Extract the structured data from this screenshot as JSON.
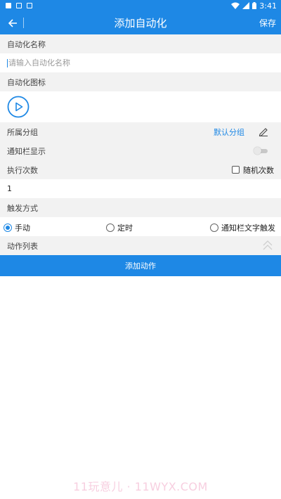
{
  "status_bar": {
    "time": "3:41"
  },
  "app_bar": {
    "title": "添加自动化",
    "save_label": "保存"
  },
  "name_section": {
    "label": "自动化名称",
    "placeholder": "请输入自动化名称",
    "value": ""
  },
  "icon_section": {
    "label": "自动化图标",
    "icon": "play-circle-icon"
  },
  "group": {
    "label": "所属分组",
    "value": "默认分组"
  },
  "notify": {
    "label": "通知栏显示",
    "enabled": false
  },
  "exec_count": {
    "label": "执行次数",
    "random_label": "随机次数",
    "random_checked": false,
    "value": "1"
  },
  "trigger": {
    "label": "触发方式",
    "options": [
      {
        "label": "手动",
        "selected": true
      },
      {
        "label": "定时",
        "selected": false
      },
      {
        "label": "通知栏文字触发",
        "selected": false
      }
    ]
  },
  "actions": {
    "label": "动作列表",
    "add_label": "添加动作"
  },
  "watermark": "11玩意儿 · 11WYX.COM",
  "colors": {
    "primary": "#1e88e5",
    "section_bg": "#f2f2f2",
    "watermark": "#f7cfe0"
  }
}
